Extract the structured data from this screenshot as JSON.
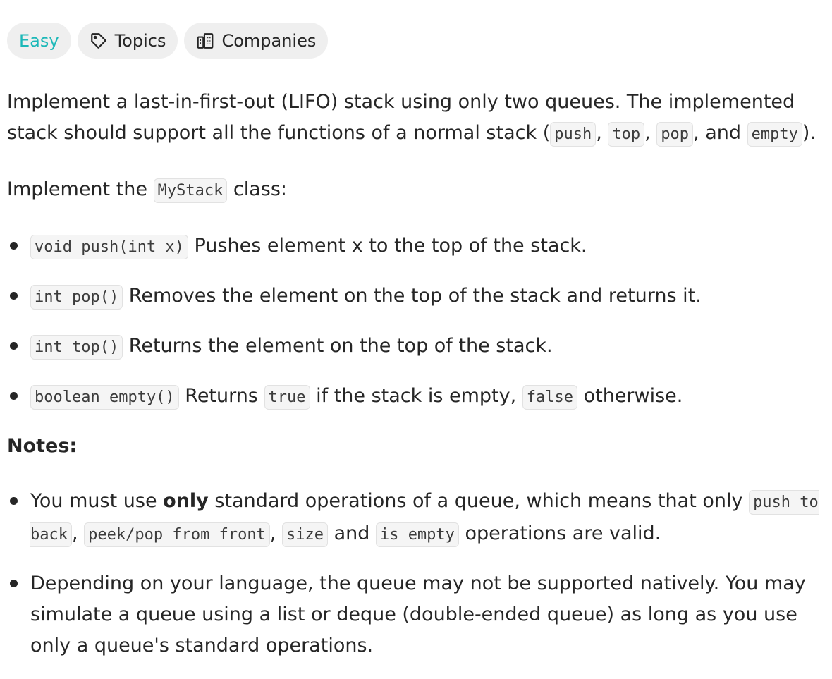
{
  "tags": {
    "difficulty": "Easy",
    "topics": "Topics",
    "companies": "Companies"
  },
  "intro": {
    "t1": "Implement a last-in-first-out (LIFO) stack using only two queues. The implemented stack should support all the functions of a normal stack (",
    "c1": "push",
    "s1": ", ",
    "c2": "top",
    "s2": ", ",
    "c3": "pop",
    "s3": ", and ",
    "c4": "empty",
    "t2": ")."
  },
  "impl": {
    "t1": "Implement the ",
    "code": "MyStack",
    "t2": " class:"
  },
  "methods": [
    {
      "code": "void push(int x)",
      "text": " Pushes element x to the top of the stack."
    },
    {
      "code": "int pop()",
      "text": " Removes the element on the top of the stack and returns it."
    },
    {
      "code": "int top()",
      "text": " Returns the element on the top of the stack."
    },
    {
      "code": "boolean empty()",
      "text": " Returns ",
      "code2": "true",
      "text2": " if the stack is empty, ",
      "code3": "false",
      "text3": " otherwise."
    }
  ],
  "notes_title": "Notes:",
  "notes": {
    "n1": {
      "t1": "You must use ",
      "bold": "only",
      "t2": " standard operations of a queue, which means that only ",
      "c1": "push to back",
      "s1": ", ",
      "c2": "peek/pop from front",
      "s2": ", ",
      "c3": "size",
      "s3": " and ",
      "c4": "is empty",
      "t3": " operations are valid."
    },
    "n2": "Depending on your language, the queue may not be supported natively. You may simulate a queue using a list or deque (double-ended queue) as long as you use only a queue's standard operations."
  },
  "icons": {
    "topics": "tag-icon",
    "companies": "building-icon"
  },
  "colors": {
    "easy": "#1cb8b8",
    "text": "#262626",
    "tag_bg": "#efefef",
    "code_bg": "#f5f5f5"
  }
}
